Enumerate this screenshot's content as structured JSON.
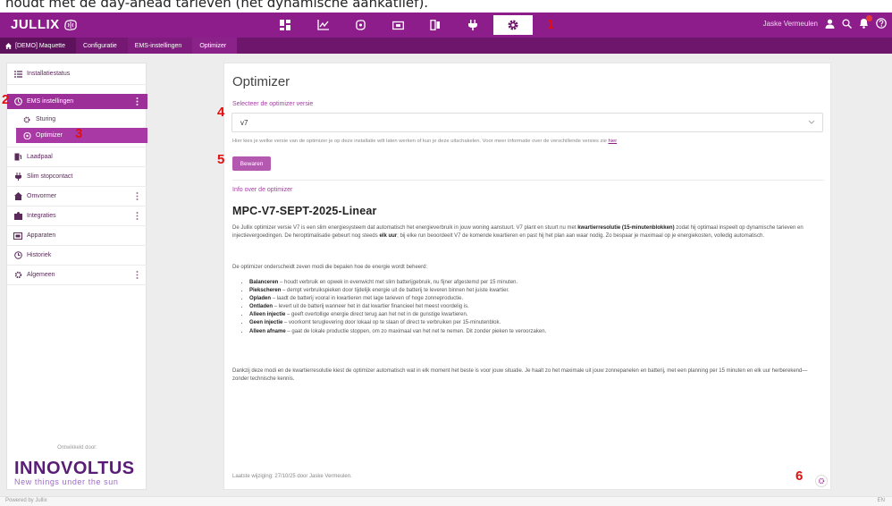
{
  "document_caption": "houdt met de day-ahead tarieven (het dynamische aankatlief).",
  "header": {
    "app_name": "JULLIX",
    "user_name": "Jaske Vermeulen",
    "nav_icons": [
      "dashboard-icon",
      "chart-icon",
      "brain-icon",
      "battery-box-icon",
      "phone-icon",
      "plug-icon",
      "gear-icon"
    ]
  },
  "breadcrumbs": [
    "[DEMO] Maquette",
    "Configuratie",
    "EMS-instellingen",
    "Optimizer"
  ],
  "sidebar": {
    "items": [
      {
        "label": "Installatiestatus"
      },
      {
        "label": "EMS instellingen"
      },
      {
        "label": "Sturing"
      },
      {
        "label": "Optimizer"
      },
      {
        "label": "Laadpaal"
      },
      {
        "label": "Slim stopcontact"
      },
      {
        "label": "Omvormer"
      },
      {
        "label": "Integraties"
      },
      {
        "label": "Apparaten"
      },
      {
        "label": "Historiek"
      },
      {
        "label": "Algemeen"
      }
    ],
    "powered_by": "Ontwikkeld door:",
    "brand": "INNOVOLTUS",
    "tagline": "New things under the sun"
  },
  "main": {
    "title": "Optimizer",
    "select_label": "Selecteer de optimizer versie",
    "select_value": "v7",
    "help_text": "Hier kies je welke versie van de optimizer je op deze installatie wilt laten werken of kun je deze uitschakelen. Voor meer informatie over de verschillende versies zie",
    "help_link": "hier",
    "save_label": "Bewaren",
    "info_label": "Info over de optimizer",
    "algo_title": "MPC-V7-SEPT-2025-Linear",
    "para1_a": "De Jullix optimizer versie V7 is een slim energiesysteem dat automatisch het energieverbruik in jouw woning aanstuurt. V7 plant en stuurt nu met",
    "para1_b1": "kwartierresolutie (15-minutenblokken)",
    "para1_c": "zodat hij optimaal inspeelt op dynamische tarieven en injectievergoedingen. De heroptimalisatie gebeurt nog steeds",
    "para1_b2": "elk uur",
    "para1_d": "; bij elke run beoordeelt V7 de komende kwartieren en past hij het plan aan waar nodig. Zo bespaar je maximaal op je energiekosten, volledig automatisch.",
    "para2": "De optimizer onderscheidt zeven modi die bepalen hoe de energie wordt beheerd:",
    "modes": [
      {
        "name": "Balanceren",
        "desc": "– houdt verbruik en opwek in evenwicht met slim batterijgebruik, nu fijner afgestemd per 15 minuten."
      },
      {
        "name": "Piekscheren",
        "desc": "– dempt verbruikspieken door tijdelijk energie uit de batterij te leveren binnen het juiste kwartier."
      },
      {
        "name": "Opladen",
        "desc": "– laadt de batterij vooral in kwartieren met lage tarieven of hoge zonneproductie."
      },
      {
        "name": "Ontladen",
        "desc": "– levert uit de batterij wanneer het in dat kwartier financieel het meest voordelig is."
      },
      {
        "name": "Alleen injectie",
        "desc": "– geeft overtollige energie direct terug aan het net in de gunstige kwartieren."
      },
      {
        "name": "Geen injectie",
        "desc": "– voorkomt teruglevering door lokaal op te slaan of direct te verbruiken per 15-minutenblok."
      },
      {
        "name": "Alleen afname",
        "desc": "– gaat de lokale productie stoppen, om zo maximaal van het net te nemen. Dit zonder pieken te veroorzaken."
      }
    ],
    "para3": "Dankzij deze modi en de kwartierresolutie kiest de optimizer automatisch wat in elk moment het beste is voor jouw situatie. Je haalt zo het maximale uit jouw zonnepanelen en batterij, met een planning per 15 minuten en elk uur herberekend—zonder technische kennis.",
    "footer": "Laatste wijziging: 27/10/25 door Jaske Vermeulen."
  },
  "annotations": [
    "1",
    "2",
    "3",
    "4",
    "5",
    "6"
  ],
  "bottom_bar": {
    "left": "Powered by Jullix",
    "right": "EN"
  },
  "colors": {
    "primary": "#8e1d8c",
    "active": "#9c2f98",
    "annotation": "#e01010",
    "brand": "#5a1d77"
  }
}
